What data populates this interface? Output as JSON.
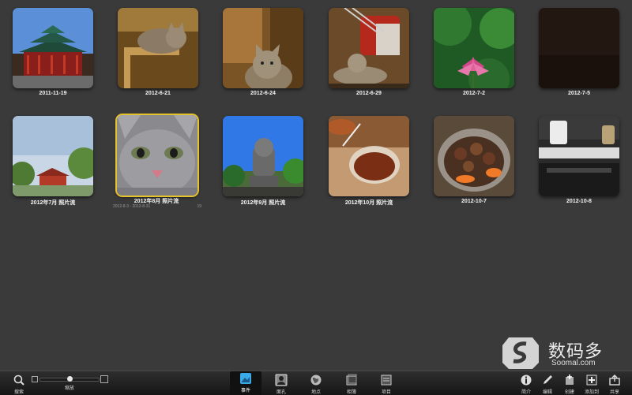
{
  "events": [
    {
      "label": "2011-11-19"
    },
    {
      "label": "2012-6-21"
    },
    {
      "label": "2012-6-24"
    },
    {
      "label": "2012-6-29"
    },
    {
      "label": "2012-7-2"
    },
    {
      "label": "2012-7-5"
    },
    {
      "label": "2012年7月 照片流"
    },
    {
      "label": "2012年8月 照片流",
      "dates": "2012-8-3 - 2012-8-31",
      "count": "19",
      "selected": true
    },
    {
      "label": "2012年9月 照片流"
    },
    {
      "label": "2012年10月 照片流"
    },
    {
      "label": "2012-10-7"
    },
    {
      "label": "2012-10-8"
    }
  ],
  "toolbar": {
    "search": "搜索",
    "zoom": "缩放",
    "zoom_level": 0.5,
    "tabs": [
      "事件",
      "面孔",
      "地点",
      "相簿",
      "项目"
    ],
    "active_tab": "事件",
    "actions": [
      "简介",
      "编辑",
      "创建",
      "添加到",
      "共享"
    ]
  },
  "watermark": {
    "text": "数码多",
    "url": "Soomal.com"
  },
  "colors": {
    "background": "#3a3a3a",
    "selection": "#e8c229",
    "active_tab_icon": "#3aa9e8"
  }
}
